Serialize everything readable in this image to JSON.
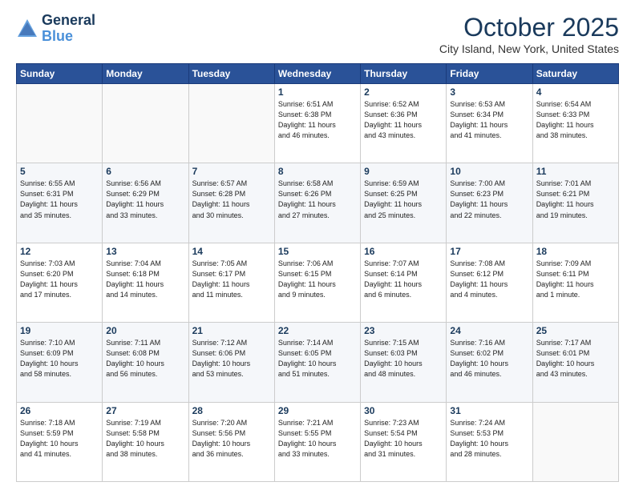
{
  "header": {
    "logo_line1": "General",
    "logo_line2": "Blue",
    "month": "October 2025",
    "location": "City Island, New York, United States"
  },
  "days_of_week": [
    "Sunday",
    "Monday",
    "Tuesday",
    "Wednesday",
    "Thursday",
    "Friday",
    "Saturday"
  ],
  "weeks": [
    [
      {
        "day": "",
        "info": ""
      },
      {
        "day": "",
        "info": ""
      },
      {
        "day": "",
        "info": ""
      },
      {
        "day": "1",
        "info": "Sunrise: 6:51 AM\nSunset: 6:38 PM\nDaylight: 11 hours\nand 46 minutes."
      },
      {
        "day": "2",
        "info": "Sunrise: 6:52 AM\nSunset: 6:36 PM\nDaylight: 11 hours\nand 43 minutes."
      },
      {
        "day": "3",
        "info": "Sunrise: 6:53 AM\nSunset: 6:34 PM\nDaylight: 11 hours\nand 41 minutes."
      },
      {
        "day": "4",
        "info": "Sunrise: 6:54 AM\nSunset: 6:33 PM\nDaylight: 11 hours\nand 38 minutes."
      }
    ],
    [
      {
        "day": "5",
        "info": "Sunrise: 6:55 AM\nSunset: 6:31 PM\nDaylight: 11 hours\nand 35 minutes."
      },
      {
        "day": "6",
        "info": "Sunrise: 6:56 AM\nSunset: 6:29 PM\nDaylight: 11 hours\nand 33 minutes."
      },
      {
        "day": "7",
        "info": "Sunrise: 6:57 AM\nSunset: 6:28 PM\nDaylight: 11 hours\nand 30 minutes."
      },
      {
        "day": "8",
        "info": "Sunrise: 6:58 AM\nSunset: 6:26 PM\nDaylight: 11 hours\nand 27 minutes."
      },
      {
        "day": "9",
        "info": "Sunrise: 6:59 AM\nSunset: 6:25 PM\nDaylight: 11 hours\nand 25 minutes."
      },
      {
        "day": "10",
        "info": "Sunrise: 7:00 AM\nSunset: 6:23 PM\nDaylight: 11 hours\nand 22 minutes."
      },
      {
        "day": "11",
        "info": "Sunrise: 7:01 AM\nSunset: 6:21 PM\nDaylight: 11 hours\nand 19 minutes."
      }
    ],
    [
      {
        "day": "12",
        "info": "Sunrise: 7:03 AM\nSunset: 6:20 PM\nDaylight: 11 hours\nand 17 minutes."
      },
      {
        "day": "13",
        "info": "Sunrise: 7:04 AM\nSunset: 6:18 PM\nDaylight: 11 hours\nand 14 minutes."
      },
      {
        "day": "14",
        "info": "Sunrise: 7:05 AM\nSunset: 6:17 PM\nDaylight: 11 hours\nand 11 minutes."
      },
      {
        "day": "15",
        "info": "Sunrise: 7:06 AM\nSunset: 6:15 PM\nDaylight: 11 hours\nand 9 minutes."
      },
      {
        "day": "16",
        "info": "Sunrise: 7:07 AM\nSunset: 6:14 PM\nDaylight: 11 hours\nand 6 minutes."
      },
      {
        "day": "17",
        "info": "Sunrise: 7:08 AM\nSunset: 6:12 PM\nDaylight: 11 hours\nand 4 minutes."
      },
      {
        "day": "18",
        "info": "Sunrise: 7:09 AM\nSunset: 6:11 PM\nDaylight: 11 hours\nand 1 minute."
      }
    ],
    [
      {
        "day": "19",
        "info": "Sunrise: 7:10 AM\nSunset: 6:09 PM\nDaylight: 10 hours\nand 58 minutes."
      },
      {
        "day": "20",
        "info": "Sunrise: 7:11 AM\nSunset: 6:08 PM\nDaylight: 10 hours\nand 56 minutes."
      },
      {
        "day": "21",
        "info": "Sunrise: 7:12 AM\nSunset: 6:06 PM\nDaylight: 10 hours\nand 53 minutes."
      },
      {
        "day": "22",
        "info": "Sunrise: 7:14 AM\nSunset: 6:05 PM\nDaylight: 10 hours\nand 51 minutes."
      },
      {
        "day": "23",
        "info": "Sunrise: 7:15 AM\nSunset: 6:03 PM\nDaylight: 10 hours\nand 48 minutes."
      },
      {
        "day": "24",
        "info": "Sunrise: 7:16 AM\nSunset: 6:02 PM\nDaylight: 10 hours\nand 46 minutes."
      },
      {
        "day": "25",
        "info": "Sunrise: 7:17 AM\nSunset: 6:01 PM\nDaylight: 10 hours\nand 43 minutes."
      }
    ],
    [
      {
        "day": "26",
        "info": "Sunrise: 7:18 AM\nSunset: 5:59 PM\nDaylight: 10 hours\nand 41 minutes."
      },
      {
        "day": "27",
        "info": "Sunrise: 7:19 AM\nSunset: 5:58 PM\nDaylight: 10 hours\nand 38 minutes."
      },
      {
        "day": "28",
        "info": "Sunrise: 7:20 AM\nSunset: 5:56 PM\nDaylight: 10 hours\nand 36 minutes."
      },
      {
        "day": "29",
        "info": "Sunrise: 7:21 AM\nSunset: 5:55 PM\nDaylight: 10 hours\nand 33 minutes."
      },
      {
        "day": "30",
        "info": "Sunrise: 7:23 AM\nSunset: 5:54 PM\nDaylight: 10 hours\nand 31 minutes."
      },
      {
        "day": "31",
        "info": "Sunrise: 7:24 AM\nSunset: 5:53 PM\nDaylight: 10 hours\nand 28 minutes."
      },
      {
        "day": "",
        "info": ""
      }
    ]
  ]
}
